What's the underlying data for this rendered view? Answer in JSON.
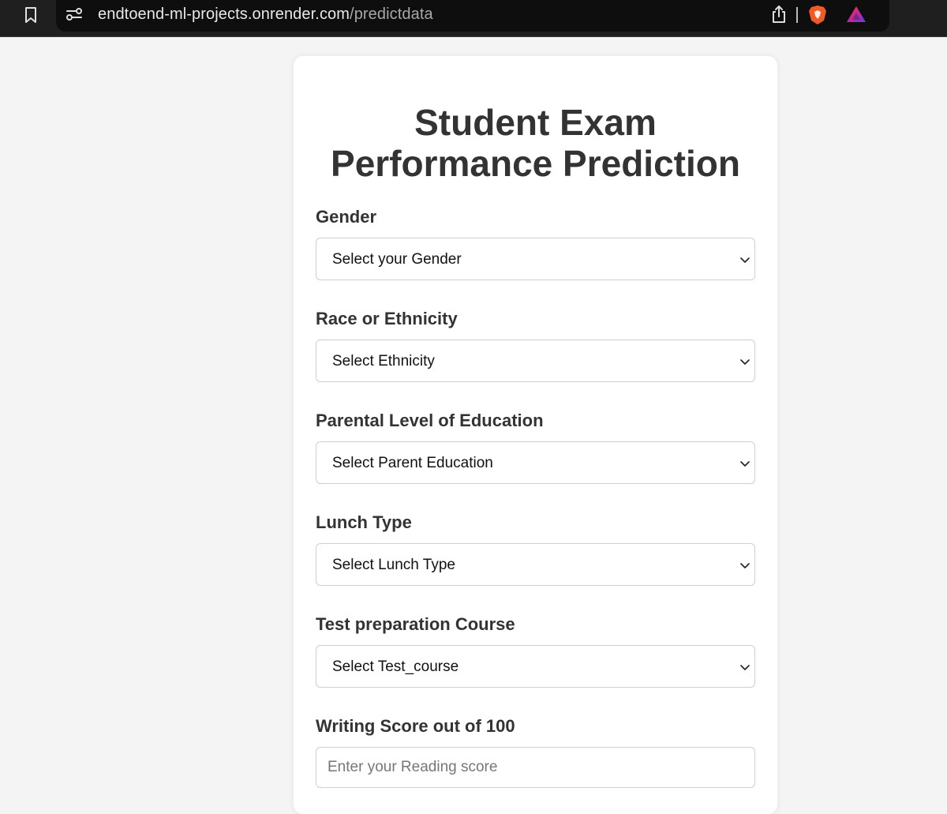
{
  "browser": {
    "url_domain": "endtoend-ml-projects.onrender.com",
    "url_path": "/predictdata",
    "colors": {
      "bar": "#1f1f1f",
      "brave_orange": "#f15a24"
    }
  },
  "page": {
    "title_line1": "Student Exam",
    "title_line2": "Performance Prediction"
  },
  "form": {
    "gender": {
      "label": "Gender",
      "selected": "Select your Gender"
    },
    "ethnicity": {
      "label": "Race or Ethnicity",
      "selected": "Select Ethnicity"
    },
    "parental_education": {
      "label": "Parental Level of Education",
      "selected": "Select Parent Education"
    },
    "lunch": {
      "label": "Lunch Type",
      "selected": "Select Lunch Type"
    },
    "test_prep": {
      "label": "Test preparation Course",
      "selected": "Select Test_course"
    },
    "writing_score": {
      "label": "Writing Score out of 100",
      "placeholder": "Enter your Reading score"
    }
  }
}
